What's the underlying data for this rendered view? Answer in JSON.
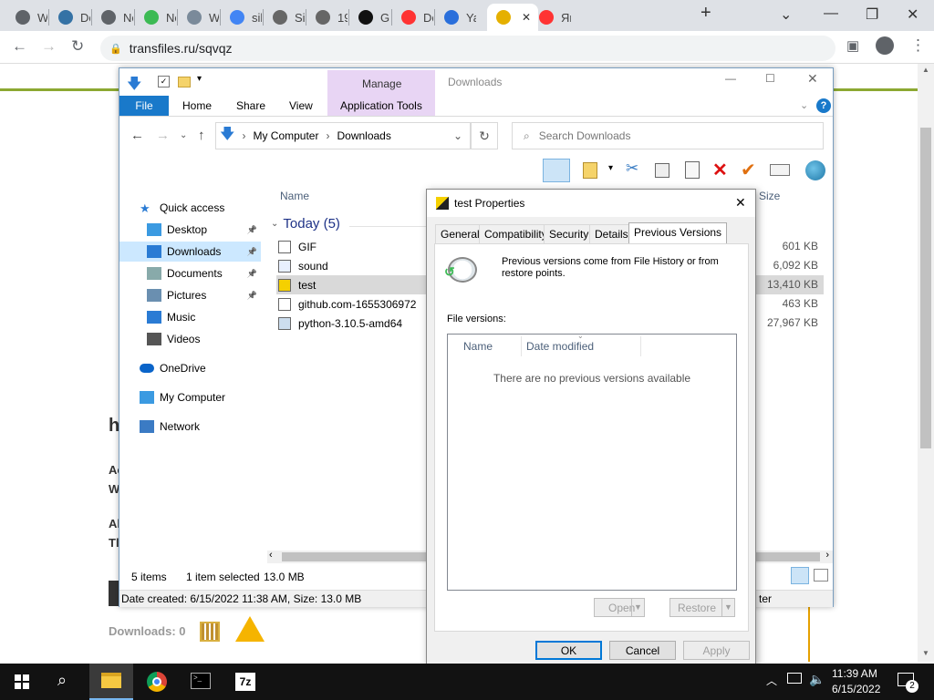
{
  "browser": {
    "tabs": [
      {
        "label": "Wh",
        "icon": "chrome-icon",
        "color": "#5f6368"
      },
      {
        "label": "Do",
        "icon": "python-icon",
        "color": "#3572a5"
      },
      {
        "label": "Ne",
        "icon": "chrome-icon",
        "color": "#5f6368"
      },
      {
        "label": "Ne",
        "icon": "refresh-swirl-icon",
        "color": "#3cba54"
      },
      {
        "label": "We",
        "icon": "feather-icon",
        "color": "#7a8a9a"
      },
      {
        "label": "sile",
        "icon": "google-icon",
        "color": "#4285f4"
      },
      {
        "label": "Site",
        "icon": "globe-icon",
        "color": "#666"
      },
      {
        "label": "197",
        "icon": "globe-icon",
        "color": "#666"
      },
      {
        "label": "Git",
        "icon": "github-icon",
        "color": "#111"
      },
      {
        "label": "Do",
        "icon": "yandex-icon",
        "color": "#f33"
      },
      {
        "label": "Yan",
        "icon": "yandex-browser-icon",
        "color": "#2a6fdb"
      },
      {
        "label": "",
        "icon": "transfiles-icon",
        "color": "#e5b000",
        "active": true
      },
      {
        "label": "Ян",
        "icon": "yandex-icon",
        "color": "#f33"
      }
    ],
    "url": "transfiles.ru/sqvqz"
  },
  "page": {
    "heading_letter": "h",
    "lines": [
      "Ac",
      "W",
      "Al",
      "Tl"
    ],
    "downloads_label": "Downloads: 0"
  },
  "explorer": {
    "qat_title": "Downloads",
    "manage_label": "Manage",
    "ribbon_tabs": [
      "File",
      "Home",
      "Share",
      "View",
      "Application Tools"
    ],
    "breadcrumb": [
      "My Computer",
      "Downloads"
    ],
    "search_placeholder": "Search Downloads",
    "nav": [
      {
        "label": "Quick access",
        "icon": "star-icon",
        "pinned": false
      },
      {
        "label": "Desktop",
        "icon": "desktop-folder-icon",
        "pinned": true
      },
      {
        "label": "Downloads",
        "icon": "downloads-folder-icon",
        "pinned": true,
        "selected": true
      },
      {
        "label": "Documents",
        "icon": "documents-folder-icon",
        "pinned": true
      },
      {
        "label": "Pictures",
        "icon": "pictures-folder-icon",
        "pinned": true
      },
      {
        "label": "Music",
        "icon": "music-folder-icon",
        "pinned": false
      },
      {
        "label": "Videos",
        "icon": "videos-folder-icon",
        "pinned": false
      },
      {
        "label": "OneDrive",
        "icon": "onedrive-icon",
        "pinned": false
      },
      {
        "label": "My Computer",
        "icon": "computer-icon",
        "pinned": false
      },
      {
        "label": "Network",
        "icon": "network-icon",
        "pinned": false
      }
    ],
    "columns": {
      "name": "Name",
      "size": "Size"
    },
    "group": "Today (5)",
    "files": [
      {
        "name": "GIF",
        "size": "601 KB",
        "icon": "gif-file-icon"
      },
      {
        "name": "sound",
        "size": "6,092 KB",
        "icon": "audio-file-icon"
      },
      {
        "name": "test",
        "size": "13,410 KB",
        "icon": "exe-file-icon",
        "selected": true
      },
      {
        "name": "github.com-1655306972",
        "size": "463 KB",
        "icon": "zip-file-icon"
      },
      {
        "name": "python-3.10.5-amd64",
        "size": "27,967 KB",
        "icon": "installer-file-icon"
      }
    ],
    "status": {
      "items": "5 items",
      "selected": "1 item selected",
      "size": "13.0 MB"
    },
    "details_bar": "Date created: 6/15/2022 11:38 AM, Size: 13.0 MB",
    "details_bar_right": "ter"
  },
  "dialog": {
    "title": "test Properties",
    "tabs": [
      "General",
      "Compatibility",
      "Security",
      "Details",
      "Previous Versions"
    ],
    "info": "Previous versions come from File History or from restore points.",
    "file_versions_label": "File versions:",
    "list_columns": [
      "Name",
      "Date modified"
    ],
    "empty_message": "There are no previous versions available",
    "open_label": "Open",
    "restore_label": "Restore",
    "ok_label": "OK",
    "cancel_label": "Cancel",
    "apply_label": "Apply"
  },
  "taskbar": {
    "time": "11:39 AM",
    "date": "6/15/2022",
    "notifications": "2",
    "apps": [
      "start-icon",
      "search-icon",
      "file-explorer-icon",
      "chrome-icon",
      "terminal-icon",
      "7zip-icon"
    ]
  }
}
